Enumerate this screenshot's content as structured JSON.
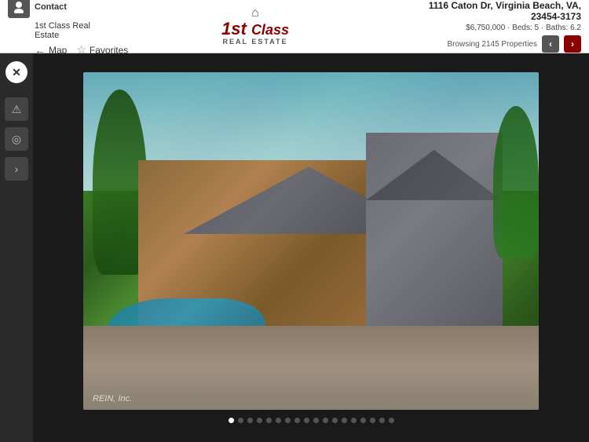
{
  "header": {
    "contact_label": "Contact",
    "agency_name": "1st Class Real Estate",
    "map_label": "Map",
    "favorites_label": "Favorites",
    "logo_line1": "1st Class",
    "logo_line2": "REAL ESTATE",
    "property_address": "1116 Caton Dr, Virginia Beach, VA, 23454-3173",
    "property_price": "$6,750,000",
    "property_beds": "Beds: 5",
    "property_baths": "Baths: 6.2",
    "browse_text": "Browsing 2145 Properties"
  },
  "sidebar": {
    "close_label": "✕",
    "icon1": "▲",
    "icon2": "◎",
    "icon3": "›"
  },
  "photo": {
    "watermark": "REIN, Inc.",
    "dots_count": 18,
    "active_dot": 0
  }
}
